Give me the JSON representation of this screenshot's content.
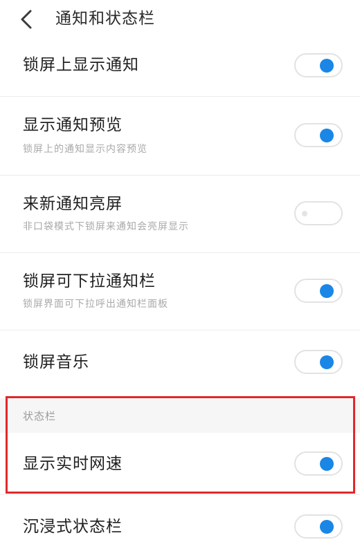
{
  "header": {
    "title": "通知和状态栏",
    "back_icon": "chevron-left-icon"
  },
  "rows": [
    {
      "title": "锁屏上显示通知",
      "subtitle": "",
      "toggle": "on"
    },
    {
      "title": "显示通知预览",
      "subtitle": "锁屏上的通知显示内容预览",
      "toggle": "on"
    },
    {
      "title": "来新通知亮屏",
      "subtitle": "非口袋模式下锁屏来通知会亮屏显示",
      "toggle": "off"
    },
    {
      "title": "锁屏可下拉通知栏",
      "subtitle": "锁屏界面可下拉呼出通知栏面板",
      "toggle": "on"
    },
    {
      "title": "锁屏音乐",
      "subtitle": "",
      "toggle": "on"
    }
  ],
  "status_section": {
    "label": "状态栏",
    "rows": [
      {
        "title": "显示实时网速",
        "toggle": "on"
      },
      {
        "title": "沉浸式状态栏",
        "toggle": "on"
      }
    ]
  },
  "colors": {
    "toggle_on": "#1a86e6",
    "highlight": "#e0292b",
    "section_bg": "#f6f6f6"
  }
}
